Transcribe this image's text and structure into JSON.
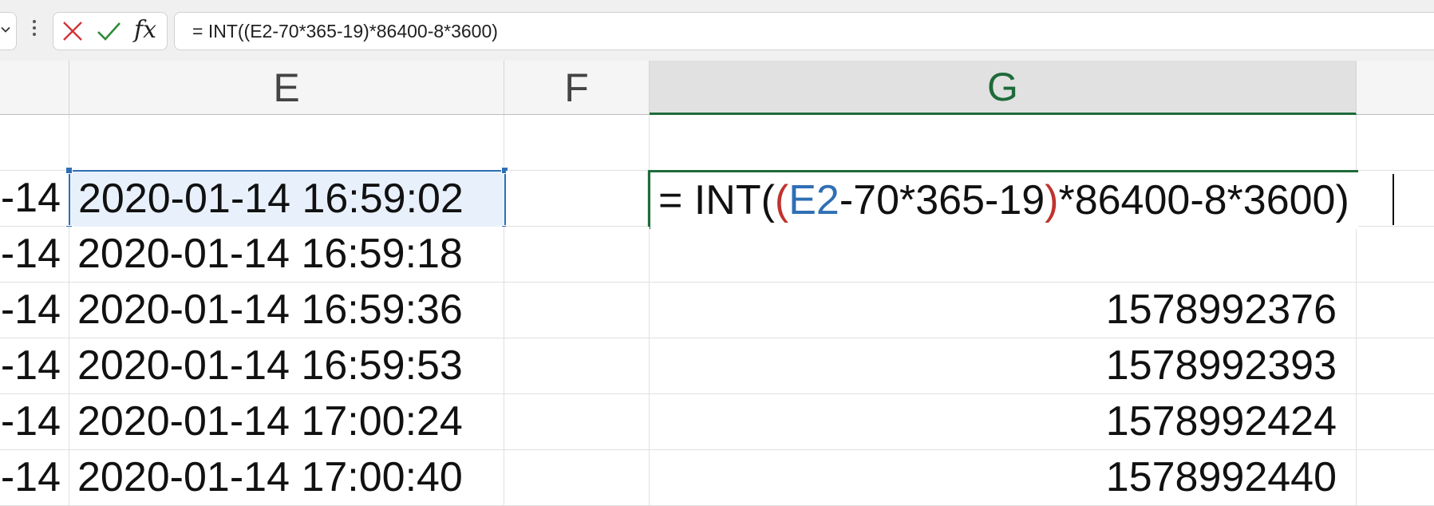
{
  "formula_bar": {
    "formula": "= INT((E2-70*365-19)*86400-8*3600)",
    "fx_label": "fx"
  },
  "columns": [
    "E",
    "F",
    "G"
  ],
  "rows": [
    {
      "d_clip": "",
      "e": "",
      "g": ""
    },
    {
      "d_clip": "-14",
      "e": "2020-01-14 16:59:02",
      "g": ""
    },
    {
      "d_clip": "-14",
      "e": "2020-01-14 16:59:18",
      "g": ""
    },
    {
      "d_clip": "-14",
      "e": "2020-01-14 16:59:36",
      "g": "1578992376"
    },
    {
      "d_clip": "-14",
      "e": "2020-01-14 16:59:53",
      "g": "1578992393"
    },
    {
      "d_clip": "-14",
      "e": "2020-01-14 17:00:24",
      "g": "1578992424"
    },
    {
      "d_clip": "-14",
      "e": "2020-01-14 17:00:40",
      "g": "1578992440"
    }
  ],
  "edit_cell": {
    "parts": {
      "prefix": "= INT(",
      "open_paren": "(",
      "ref": "E2",
      "middle": "-70*365-19",
      "close_paren": ")",
      "suffix": "*86400-8*3600)"
    }
  },
  "icons": {
    "cancel": "close-icon",
    "enter": "check-icon",
    "namebox": "chevron-down-icon",
    "more": "vertical-dots-icon"
  },
  "colors": {
    "selection_green": "#1e6b3a",
    "reference_blue": "#2f6fb5",
    "paren_red": "#c0332d"
  }
}
